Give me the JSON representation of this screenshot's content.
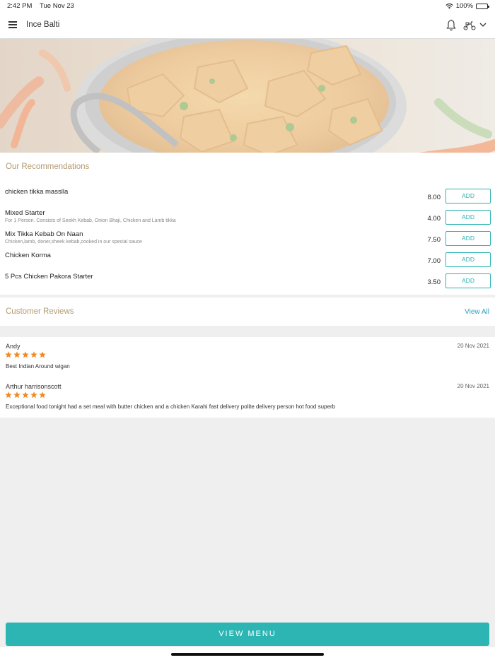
{
  "status_bar": {
    "time": "2:42 PM",
    "date": "Tue Nov 23",
    "battery": "100%"
  },
  "header": {
    "title": "Ince Balti"
  },
  "recommendations": {
    "title": "Our Recommendations",
    "add_label": "ADD",
    "items": [
      {
        "name": "chicken tikka masslla",
        "description": "",
        "price": "8.00"
      },
      {
        "name": "Mixed Starter",
        "description": "For 1 Person. Consists of Seekh Kebab, Onion Bhaji, Chicken and Lamb tikka",
        "price": "4.00"
      },
      {
        "name": "Mix Tikka Kebab On Naan",
        "description": "Chicken,lamb, doner,sheek kebab,cooked in our special sauce",
        "price": "7.50"
      },
      {
        "name": "Chicken Korma",
        "description": "",
        "price": "7.00"
      },
      {
        "name": "5 Pcs Chicken Pakora Starter",
        "description": "",
        "price": "3.50"
      }
    ]
  },
  "reviews": {
    "title": "Customer Reviews",
    "view_all": "View All",
    "items": [
      {
        "name": "Andy",
        "date": "20 Nov 2021",
        "rating": 5,
        "text": "Best Indian Around wigan"
      },
      {
        "name": "Arthur harrisonscott",
        "date": "20 Nov 2021",
        "rating": 5,
        "text": "Exceptional food tonight had a set meal with butter chicken and a chicken Karahi fast delivery polite delivery person hot food superb"
      }
    ]
  },
  "footer": {
    "view_menu_label": "VIEW MENU"
  },
  "colors": {
    "accent": "#2db5b4",
    "section_title": "#b39a72",
    "star": "#f08a24",
    "link": "#2a9fbf"
  },
  "icons": [
    "menu-icon",
    "bell-icon",
    "scooter-icon",
    "chevron-down-icon",
    "wifi-icon",
    "battery-icon",
    "star-icon"
  ]
}
